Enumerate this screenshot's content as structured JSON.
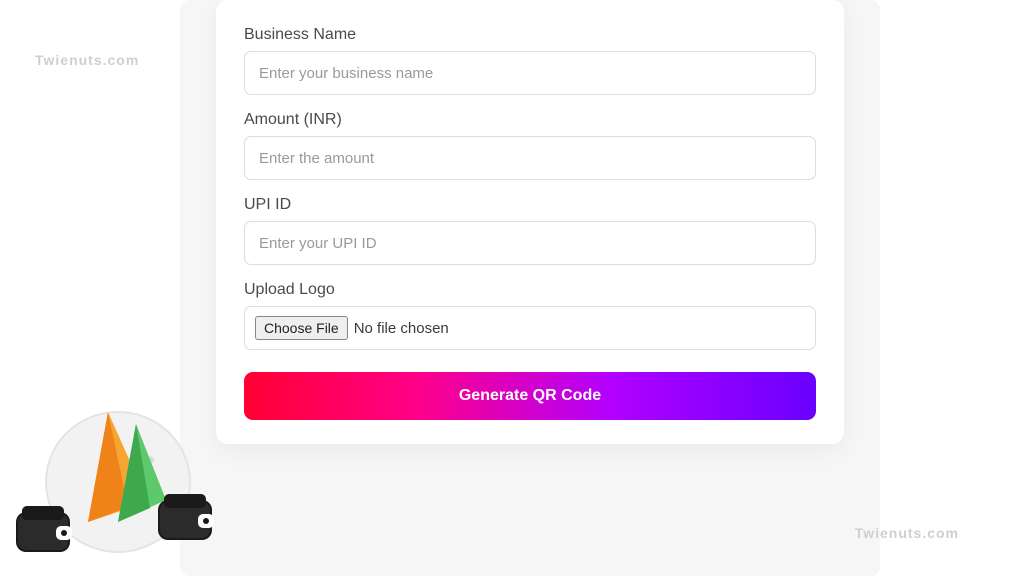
{
  "watermark": "Twienuts.com",
  "form": {
    "businessName": {
      "label": "Business Name",
      "placeholder": "Enter your business name",
      "value": ""
    },
    "amount": {
      "label": "Amount (INR)",
      "placeholder": "Enter the amount",
      "value": ""
    },
    "upiId": {
      "label": "UPI ID",
      "placeholder": "Enter your UPI ID",
      "value": ""
    },
    "uploadLogo": {
      "label": "Upload Logo",
      "buttonLabel": "Choose File",
      "status": "No file chosen"
    },
    "submitLabel": "Generate QR Code"
  }
}
